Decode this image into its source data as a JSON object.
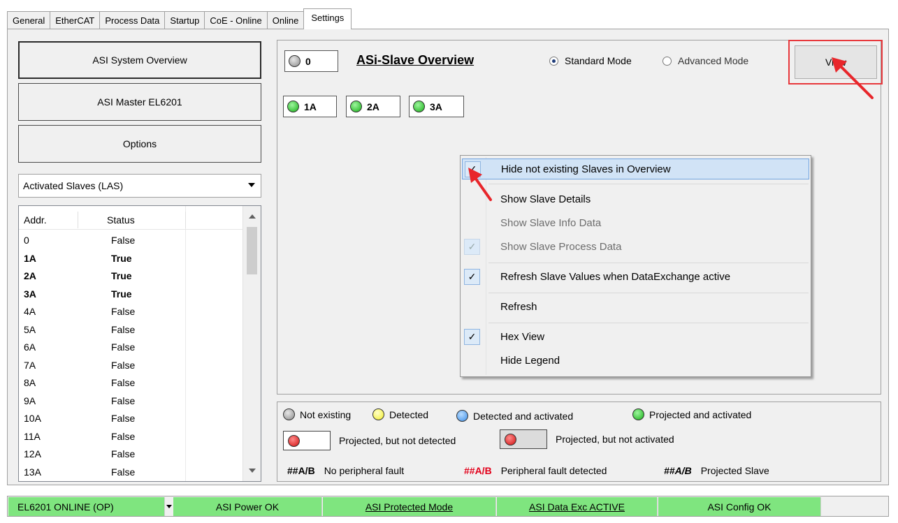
{
  "tabs": [
    "General",
    "EtherCAT",
    "Process Data",
    "Startup",
    "CoE - Online",
    "Online",
    "Settings"
  ],
  "active_tab": "Settings",
  "left": {
    "buttons": [
      "ASI System Overview",
      "ASI Master EL6201",
      "Options"
    ],
    "combo_value": "Activated Slaves (LAS)",
    "list": {
      "headers": [
        "Addr.",
        "Status"
      ],
      "rows": [
        {
          "addr": "0",
          "status": "False"
        },
        {
          "addr": "1A",
          "status": "True"
        },
        {
          "addr": "2A",
          "status": "True"
        },
        {
          "addr": "3A",
          "status": "True"
        },
        {
          "addr": "4A",
          "status": "False"
        },
        {
          "addr": "5A",
          "status": "False"
        },
        {
          "addr": "6A",
          "status": "False"
        },
        {
          "addr": "7A",
          "status": "False"
        },
        {
          "addr": "8A",
          "status": "False"
        },
        {
          "addr": "9A",
          "status": "False"
        },
        {
          "addr": "10A",
          "status": "False"
        },
        {
          "addr": "11A",
          "status": "False"
        },
        {
          "addr": "12A",
          "status": "False"
        },
        {
          "addr": "13A",
          "status": "False"
        }
      ]
    }
  },
  "overview": {
    "title": "ASi-Slave Overview",
    "counter": "0",
    "slaves": [
      "1A",
      "2A",
      "3A"
    ],
    "mode_standard": "Standard Mode",
    "mode_advanced": "Advanced Mode",
    "selected_mode": "Standard Mode",
    "view_button": "View"
  },
  "context_menu": {
    "items": [
      {
        "label": "Hide not existing Slaves in Overview",
        "checked": true,
        "enabled": true
      },
      {
        "label": "Show Slave Details",
        "checked": false,
        "enabled": true
      },
      {
        "label": "Show Slave Info Data",
        "checked": false,
        "enabled": false
      },
      {
        "label": "Show Slave Process Data",
        "checked": true,
        "enabled": false
      },
      {
        "label": "Refresh Slave Values when DataExchange active",
        "checked": true,
        "enabled": true
      },
      {
        "label": "Refresh",
        "checked": false,
        "enabled": true
      },
      {
        "label": "Hex View",
        "checked": true,
        "enabled": true
      },
      {
        "label": "Hide Legend",
        "checked": false,
        "enabled": true
      }
    ]
  },
  "legend": {
    "not_existing": "Not existing",
    "detected": "Detected",
    "detected_activated": "Detected and activated",
    "projected_activated": "Projected and activated",
    "projected_not_detected": "Projected, but not detected",
    "projected_not_activated": "Projected, but not activated",
    "tag": "##A/B",
    "no_fault": "No peripheral fault",
    "fault": "Peripheral fault detected",
    "projected_slave": "Projected Slave"
  },
  "status_bar": {
    "state": "EL6201 ONLINE (OP)",
    "power": "ASI Power OK",
    "protected": "ASI Protected Mode",
    "data_exc": "ASI Data Exc ACTIVE",
    "config": "ASI Config OK"
  },
  "colors": {
    "status_green": "#7fe57f",
    "highlight_red": "#e8383c",
    "menu_highlight": "#d1e3f6"
  }
}
